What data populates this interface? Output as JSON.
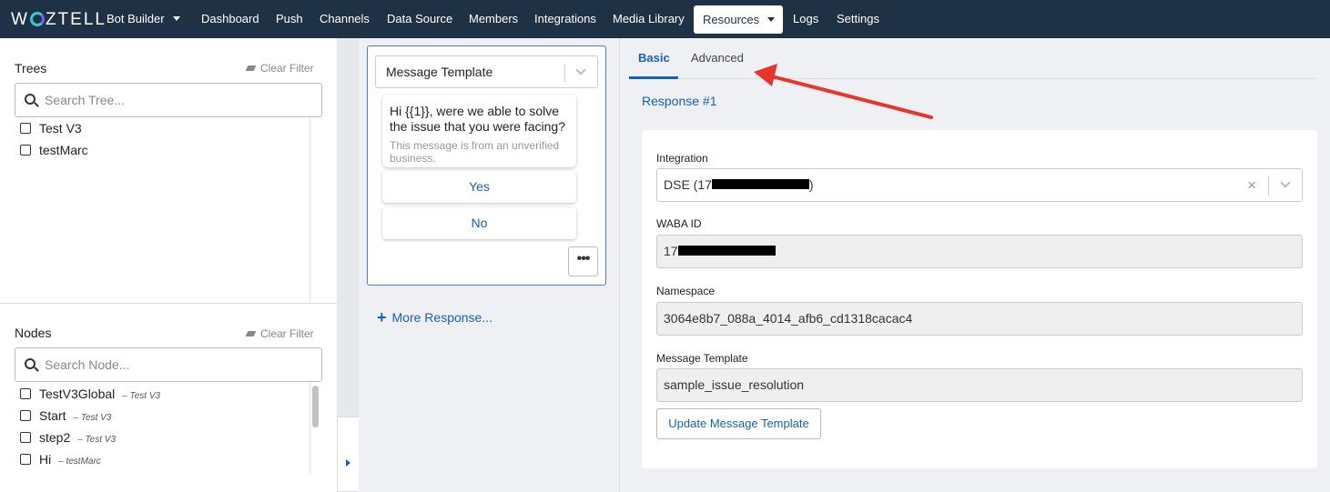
{
  "brand": {
    "logo_text_pre": "W",
    "logo_text_post": "ZTELL"
  },
  "nav": {
    "items": [
      "Bot Builder",
      "Dashboard",
      "Push",
      "Channels",
      "Data Source",
      "Members",
      "Integrations",
      "Media Library",
      "Resources",
      "Logs",
      "Settings"
    ],
    "active": "Resources"
  },
  "trees": {
    "title": "Trees",
    "clear_filter": "Clear Filter",
    "search_placeholder": "Search Tree...",
    "items": [
      "Test V3",
      "testMarc"
    ]
  },
  "nodes": {
    "title": "Nodes",
    "clear_filter": "Clear Filter",
    "search_placeholder": "Search Node...",
    "items": [
      {
        "name": "TestV3Global",
        "sep": "–",
        "tree": "Test V3"
      },
      {
        "name": "Start",
        "sep": "–",
        "tree": "Test V3"
      },
      {
        "name": "step2",
        "sep": "–",
        "tree": "Test V3"
      },
      {
        "name": "Hi",
        "sep": "–",
        "tree": "testMarc"
      }
    ]
  },
  "response_card": {
    "type_select": "Message Template",
    "message": "Hi {{1}}, were we able to solve the issue that you were facing?",
    "note": "This message is from an unverified business.",
    "buttons": [
      "Yes",
      "No"
    ],
    "more_icon": "•••",
    "more_response": "More Response..."
  },
  "tabs": {
    "basic": "Basic",
    "advanced": "Advanced",
    "active": "basic"
  },
  "response_label": "Response #1",
  "form": {
    "integration_label": "Integration",
    "integration_value_prefix": "DSE (17",
    "integration_value_suffix": ")",
    "waba_label": "WABA ID",
    "waba_value_prefix": "17",
    "namespace_label": "Namespace",
    "namespace_value": "3064e8b7_088a_4014_afb6_cd1318cacac4",
    "template_label": "Message Template",
    "template_value": "sample_issue_resolution",
    "update_button": "Update Message Template",
    "clear_icon": "×"
  },
  "colors": {
    "nav_bg": "#1f3145",
    "accent": "#1560bd",
    "annotation_arrow": "#e8342b"
  }
}
